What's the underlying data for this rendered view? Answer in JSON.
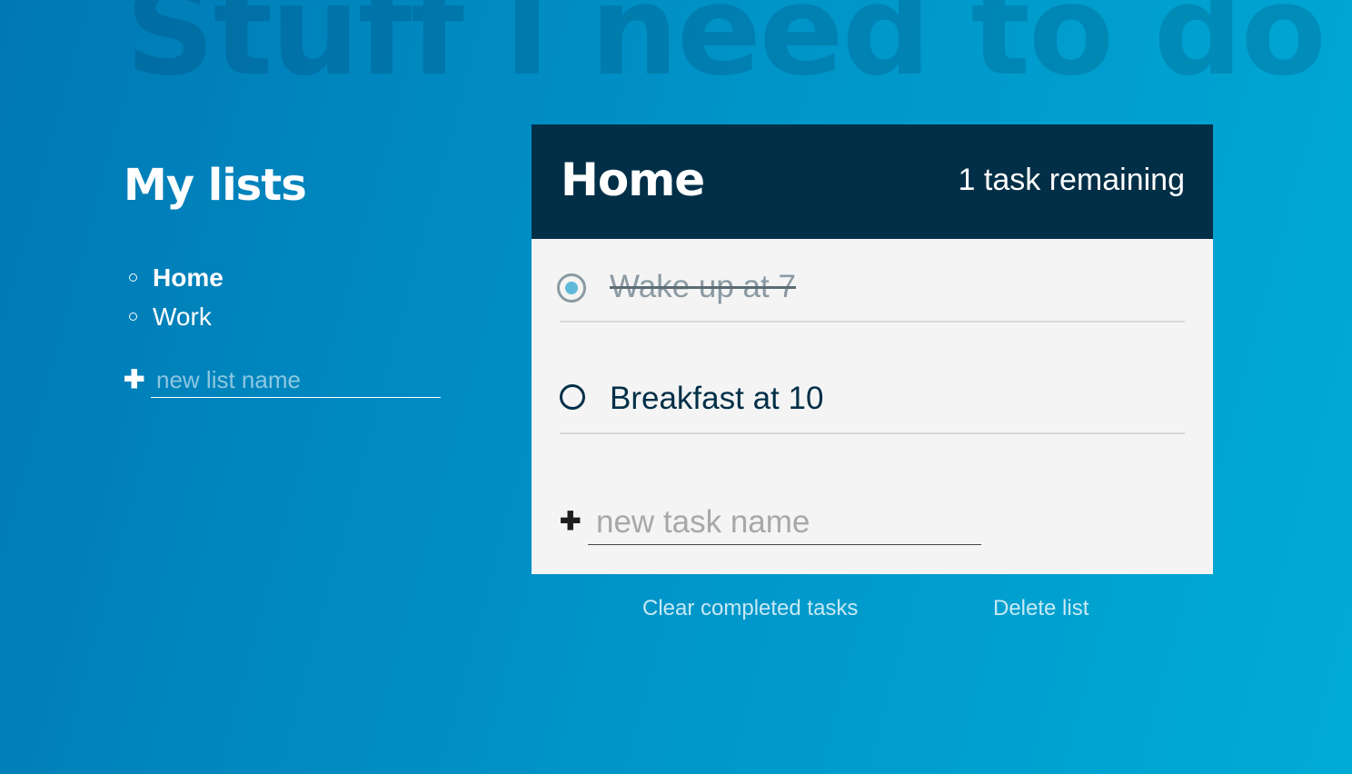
{
  "page": {
    "background_title": "Stuff I need to do",
    "colors": {
      "gradient_start": "#0078b4",
      "gradient_end": "#00abd6",
      "panel_header": "#002f47",
      "panel_body": "#f4f4f4",
      "done_check_fill": "#5fb9da"
    }
  },
  "sidebar": {
    "title": "My lists",
    "lists": [
      {
        "label": "Home",
        "active": true
      },
      {
        "label": "Work",
        "active": false
      }
    ],
    "new_list": {
      "icon": "plus-icon",
      "placeholder": "new list name",
      "value": ""
    }
  },
  "main": {
    "list_title": "Home",
    "task_count_text": "1 task remaining",
    "tasks": [
      {
        "label": "Wake up at 7",
        "completed": true
      },
      {
        "label": "Breakfast at 10",
        "completed": false
      }
    ],
    "new_task": {
      "icon": "plus-icon",
      "placeholder": "new task name",
      "value": ""
    },
    "actions": {
      "clear_completed_label": "Clear completed tasks",
      "delete_list_label": "Delete list"
    }
  }
}
